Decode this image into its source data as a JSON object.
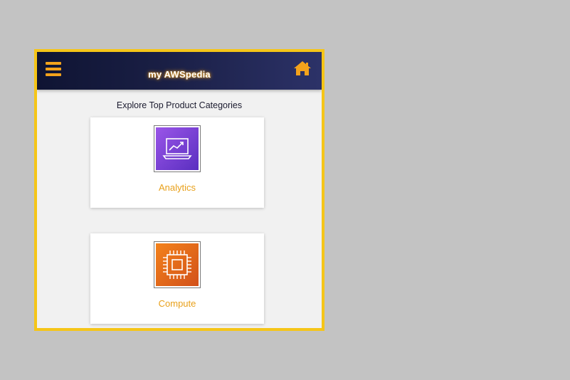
{
  "app": {
    "title": "my AWSpedia"
  },
  "header": {
    "menu_icon": "hamburger-menu-icon",
    "home_icon": "home-icon"
  },
  "main": {
    "section_title": "Explore Top Product Categories",
    "categories": [
      {
        "label": "Analytics",
        "icon": "analytics-laptop-chart-icon"
      },
      {
        "label": "Compute",
        "icon": "compute-chip-icon"
      }
    ]
  },
  "colors": {
    "frame_border": "#f5c518",
    "header_start": "#0f1433",
    "header_end": "#2c3268",
    "accent": "#f3a21c",
    "label": "#e8a01a",
    "analytics_tile": "#7b3fd6",
    "compute_tile": "#e86a1a"
  }
}
